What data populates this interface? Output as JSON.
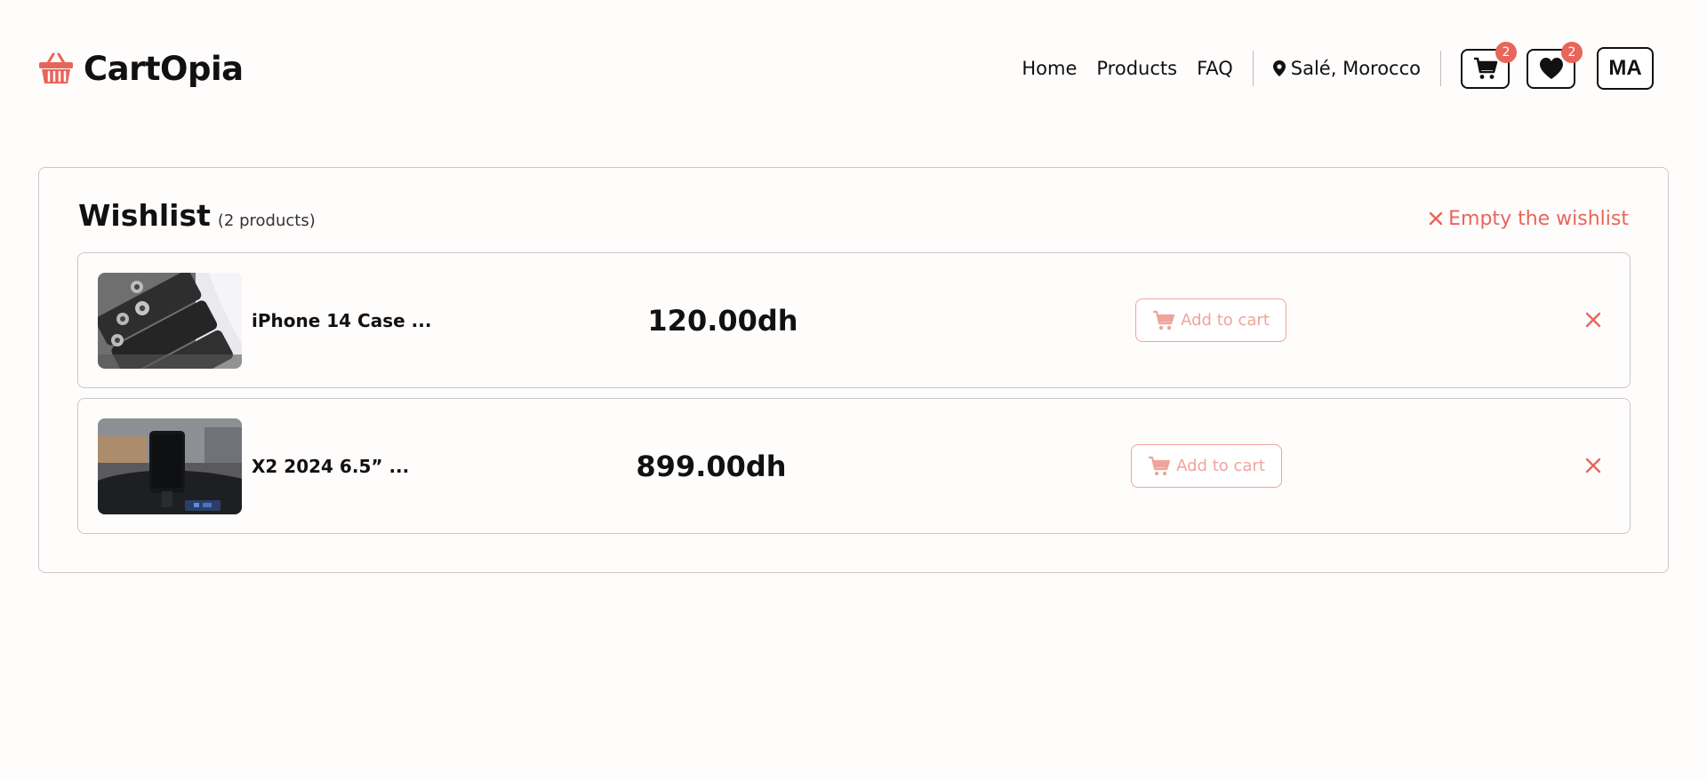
{
  "header": {
    "brand": "CartOpia",
    "nav": [
      "Home",
      "Products",
      "FAQ"
    ],
    "location": "Salé, Morocco",
    "cart_count": "2",
    "wishlist_count": "2",
    "lang": "MA"
  },
  "wishlist": {
    "title": "Wishlist",
    "count_text": "(2 products)",
    "empty_label": "Empty the wishlist",
    "items": [
      {
        "name": "iPhone 14 Case ...",
        "price": "120.00dh",
        "add_label": "Add to cart"
      },
      {
        "name": "X2 2024 6.5” ...",
        "price": "899.00dh",
        "add_label": "Add to cart"
      }
    ]
  },
  "colors": {
    "accent": "#e8655a",
    "accent_light": "#f0a39b",
    "text": "#111111",
    "border": "#c9c9c9"
  },
  "icons": {
    "logo": "basket-icon",
    "location": "map-pin-icon",
    "cart": "cart-icon",
    "wishlist": "heart-icon",
    "remove": "close-icon"
  }
}
